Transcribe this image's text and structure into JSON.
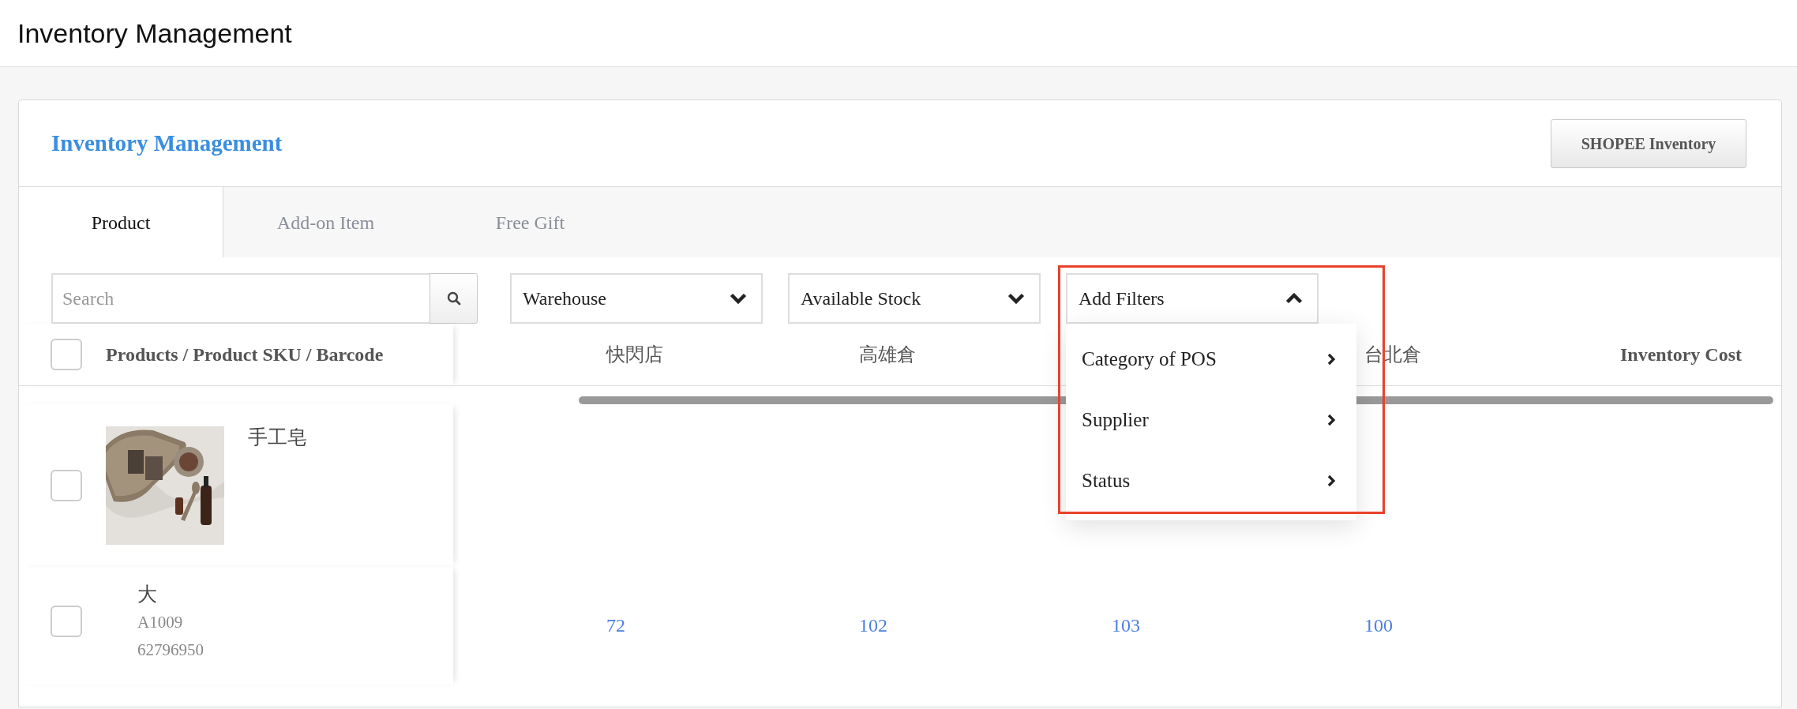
{
  "page_title": "Inventory Management",
  "card": {
    "title": "Inventory Management",
    "action_button": "SHOPEE Inventory"
  },
  "tabs": [
    {
      "label": "Product",
      "selected": true
    },
    {
      "label": "Add-on Item",
      "selected": false
    },
    {
      "label": "Free Gift",
      "selected": false
    }
  ],
  "search": {
    "placeholder": "Search"
  },
  "filters": [
    {
      "label": "Warehouse",
      "expanded": false
    },
    {
      "label": "Available Stock",
      "expanded": false
    },
    {
      "label": "Add Filters",
      "expanded": true
    }
  ],
  "filter_menu": [
    "Category of POS",
    "Supplier",
    "Status"
  ],
  "table": {
    "header_checked": false,
    "columns": [
      {
        "label": "Products / Product SKU / Barcode"
      },
      {
        "label": "快閃店"
      },
      {
        "label": "高雄倉"
      },
      {},
      {
        "label": "台北倉"
      },
      {
        "label": "Inventory Cost"
      }
    ],
    "rows": [
      {
        "kind": "product",
        "checked": false,
        "name": "手工皂"
      },
      {
        "kind": "variant",
        "checked": false,
        "name": "大",
        "sku": "A1009",
        "barcode": "62796950",
        "stock": [
          "72",
          "102",
          "103",
          "100"
        ]
      }
    ]
  }
}
